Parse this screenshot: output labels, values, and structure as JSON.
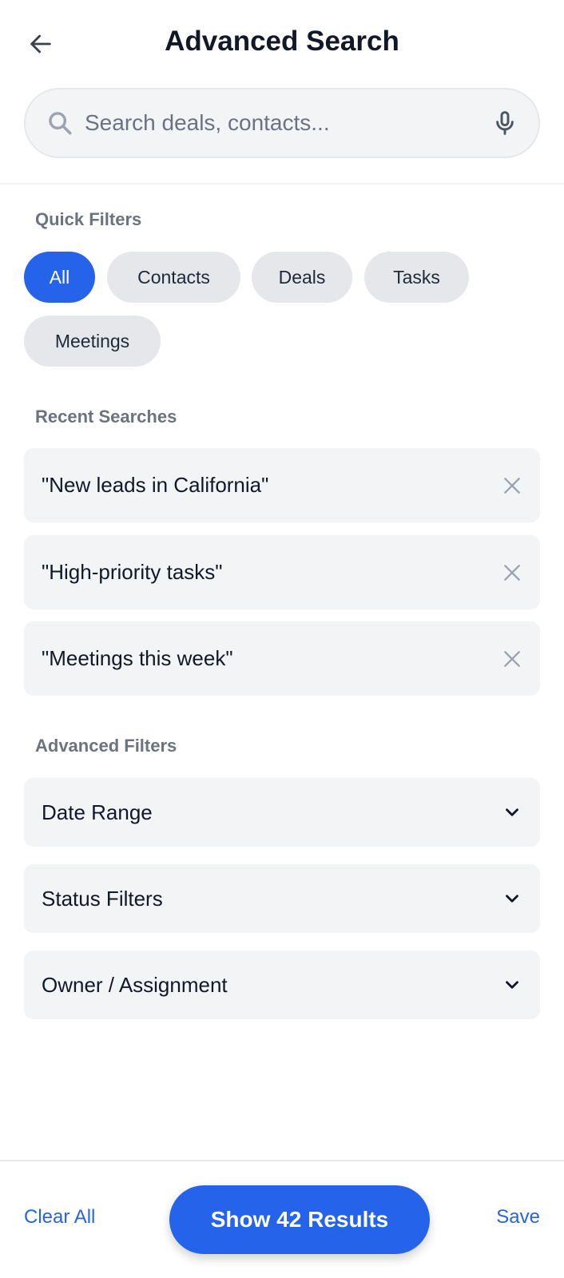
{
  "header": {
    "title": "Advanced Search"
  },
  "search": {
    "placeholder": "Search deals, contacts..."
  },
  "quick_filters": {
    "heading": "Quick Filters",
    "chips": [
      {
        "label": "All",
        "active": true
      },
      {
        "label": "Contacts"
      },
      {
        "label": "Deals"
      },
      {
        "label": "Tasks"
      },
      {
        "label": "Meetings"
      }
    ]
  },
  "recent_searches": {
    "heading": "Recent Searches",
    "items": [
      "\"New leads in California\"",
      "\"High-priority tasks\"",
      "\"Meetings this week\""
    ]
  },
  "advanced_filters": {
    "heading": "Advanced Filters",
    "items": [
      "Date Range",
      "Status Filters",
      "Owner / Assignment"
    ]
  },
  "footer": {
    "clear_label": "Clear All",
    "show_label": "Show 42 Results",
    "save_label": "Save"
  },
  "colors": {
    "accent": "#2563eb",
    "chip_bg": "#e5e7eb",
    "card_bg": "#f3f4f6"
  }
}
